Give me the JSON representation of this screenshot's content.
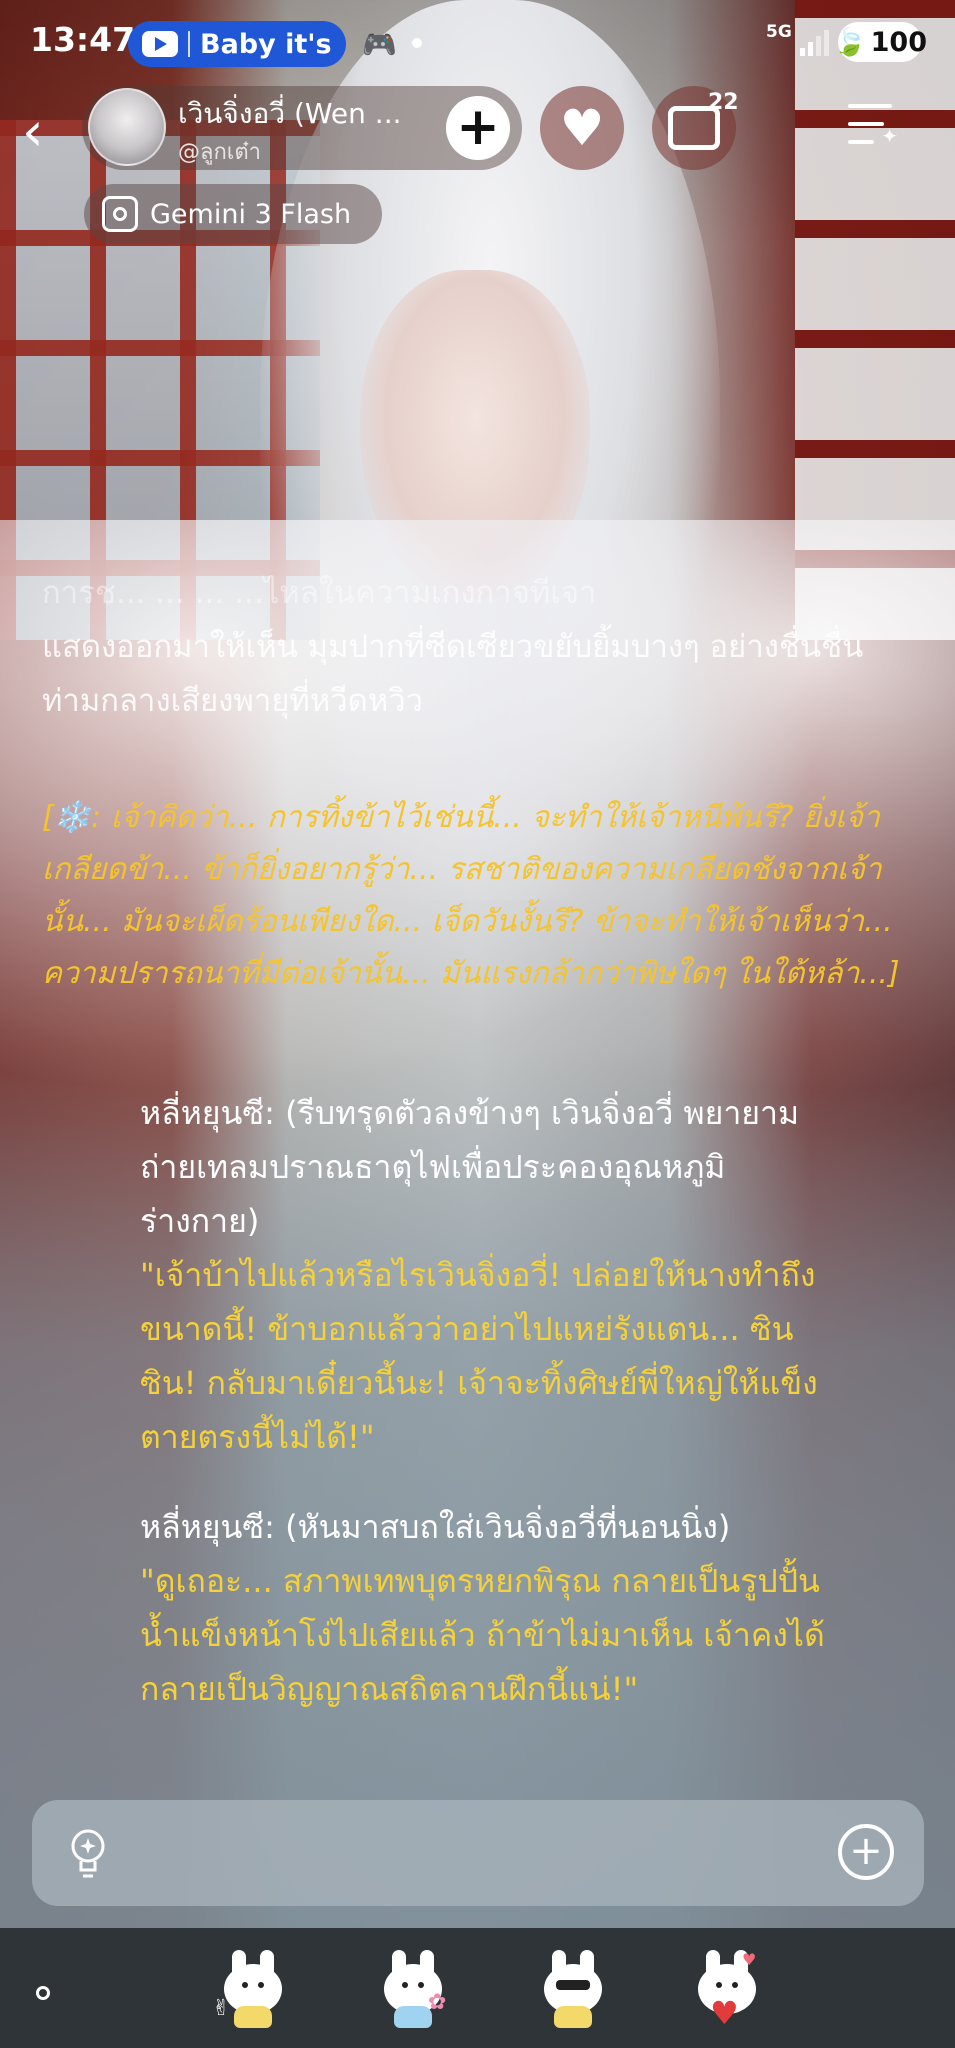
{
  "status_bar": {
    "time": "13:47",
    "media_pill_text": "Baby it's",
    "network": "5G",
    "battery": "100"
  },
  "header": {
    "character_name": "เวินจิ่งอวี่ (Wen ...",
    "handle": "@ลูกเต๋า",
    "chat_count": "22",
    "model_label": "Gemini 3 Flash"
  },
  "chat": {
    "narration_faded": "การช... ... ... ...ไหลในความเกงกาจทีเจา",
    "narration_visible": "แสดงออกมาให้เห็น มุมปากที่ซีดเซียวขยับยิ้มบางๆ อย่างชื่นชื่น ท่ามกลางเสียงพายุที่หวีดหวิว",
    "thought": "[❄️: เจ้าคิดว่า... การทิ้งข้าไว้เช่นนี้... จะทำให้เจ้าหนีพ้นรึ? ยิ่งเจ้าเกลียดข้า... ข้าก็ยิ่งอยากรู้ว่า... รสชาติของความเกลียดชังจากเจ้านั้น... มันจะเผ็ดร้อนเพียงใด... เจ็ดวันงั้นรึ? ข้าจะทำให้เจ้าเห็นว่า... ความปรารถนาที่มีต่อเจ้านั้น... มันแรงกล้ากว่าพิษใดๆ ในใต้หล้า...]",
    "block1_action": "หลี่หยุนซี: (รีบทรุดตัวลงข้างๆ เวินจิ่งอวี่ พยายามถ่ายเทลมปราณธาตุไฟเพื่อประคองอุณหภูมิร่างกาย)",
    "block1_speech": "\"เจ้าบ้าไปแล้วหรือไรเวินจิ่งอวี่! ปล่อยให้นางทำถึงขนาดนี้! ข้าบอกแล้วว่าอย่าไปแหย่รังแตน... ซินซิน! กลับมาเดี๋ยวนี้นะ! เจ้าจะทิ้งศิษย์พี่ใหญ่ให้แข็งตายตรงนี้ไม่ได้!\"",
    "block2_action": "หลี่หยุนซี: (หันมาสบถใส่เวินจิ่งอวี่ที่นอนนิ่ง)",
    "block2_speech": "\"ดูเถอะ... สภาพเทพบุตรหยกพิรุณ กลายเป็นรูปปั้นน้ำแข็งหน้าโง่ไปเสียแล้ว ถ้าข้าไม่มาเห็น เจ้าคงได้กลายเป็นวิญญาณสถิตลานฝึกนี้แน่!\""
  },
  "input": {
    "placeholder": ""
  },
  "stickers": [
    "bunny-peace-sticker",
    "bunny-flower-sticker",
    "bunny-sunglasses-sticker",
    "bunny-heart-sticker"
  ],
  "colors": {
    "thought_text": "#f4c430",
    "speech_yellow": "#f5d13a",
    "speech_cyan": "#7be6ef",
    "yt_pill": "#1f57d6"
  }
}
